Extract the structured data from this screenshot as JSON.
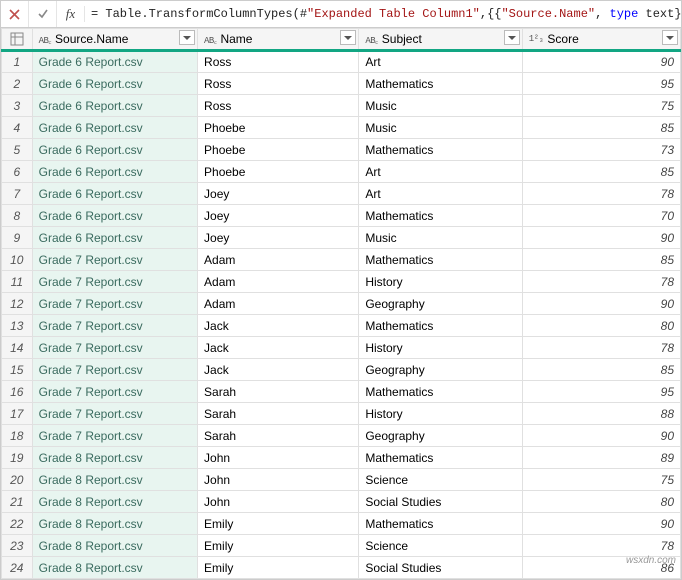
{
  "formulaBar": {
    "prefix": "= Table.TransformColumnTypes(#",
    "expanded": "\"Expanded Table Column1\"",
    "mid": ",{{",
    "sourceName": "\"Source.Name\"",
    "comma": ", ",
    "typeKw": "type ",
    "textKw": "text",
    "suffix": "},"
  },
  "columns": [
    {
      "label": "Source.Name",
      "type": "abc"
    },
    {
      "label": "Name",
      "type": "abc"
    },
    {
      "label": "Subject",
      "type": "abc"
    },
    {
      "label": "Score",
      "type": "123"
    }
  ],
  "rows": [
    {
      "n": 1,
      "src": "Grade 6 Report.csv",
      "name": "Ross",
      "subj": "Art",
      "score": 90
    },
    {
      "n": 2,
      "src": "Grade 6 Report.csv",
      "name": "Ross",
      "subj": "Mathematics",
      "score": 95
    },
    {
      "n": 3,
      "src": "Grade 6 Report.csv",
      "name": "Ross",
      "subj": "Music",
      "score": 75
    },
    {
      "n": 4,
      "src": "Grade 6 Report.csv",
      "name": "Phoebe",
      "subj": "Music",
      "score": 85
    },
    {
      "n": 5,
      "src": "Grade 6 Report.csv",
      "name": "Phoebe",
      "subj": "Mathematics",
      "score": 73
    },
    {
      "n": 6,
      "src": "Grade 6 Report.csv",
      "name": "Phoebe",
      "subj": "Art",
      "score": 85
    },
    {
      "n": 7,
      "src": "Grade 6 Report.csv",
      "name": "Joey",
      "subj": "Art",
      "score": 78
    },
    {
      "n": 8,
      "src": "Grade 6 Report.csv",
      "name": "Joey",
      "subj": "Mathematics",
      "score": 70
    },
    {
      "n": 9,
      "src": "Grade 6 Report.csv",
      "name": "Joey",
      "subj": "Music",
      "score": 90
    },
    {
      "n": 10,
      "src": "Grade 7 Report.csv",
      "name": "Adam",
      "subj": "Mathematics",
      "score": 85
    },
    {
      "n": 11,
      "src": "Grade 7 Report.csv",
      "name": "Adam",
      "subj": "History",
      "score": 78
    },
    {
      "n": 12,
      "src": "Grade 7 Report.csv",
      "name": "Adam",
      "subj": "Geography",
      "score": 90
    },
    {
      "n": 13,
      "src": "Grade 7 Report.csv",
      "name": "Jack",
      "subj": "Mathematics",
      "score": 80
    },
    {
      "n": 14,
      "src": "Grade 7 Report.csv",
      "name": "Jack",
      "subj": "History",
      "score": 78
    },
    {
      "n": 15,
      "src": "Grade 7 Report.csv",
      "name": "Jack",
      "subj": "Geography",
      "score": 85
    },
    {
      "n": 16,
      "src": "Grade 7 Report.csv",
      "name": "Sarah",
      "subj": "Mathematics",
      "score": 95
    },
    {
      "n": 17,
      "src": "Grade 7 Report.csv",
      "name": "Sarah",
      "subj": "History",
      "score": 88
    },
    {
      "n": 18,
      "src": "Grade 7 Report.csv",
      "name": "Sarah",
      "subj": "Geography",
      "score": 90
    },
    {
      "n": 19,
      "src": "Grade 8 Report.csv",
      "name": "John",
      "subj": "Mathematics",
      "score": 89
    },
    {
      "n": 20,
      "src": "Grade 8 Report.csv",
      "name": "John",
      "subj": "Science",
      "score": 75
    },
    {
      "n": 21,
      "src": "Grade 8 Report.csv",
      "name": "John",
      "subj": "Social Studies",
      "score": 80
    },
    {
      "n": 22,
      "src": "Grade 8 Report.csv",
      "name": "Emily",
      "subj": "Mathematics",
      "score": 90
    },
    {
      "n": 23,
      "src": "Grade 8 Report.csv",
      "name": "Emily",
      "subj": "Science",
      "score": 78
    },
    {
      "n": 24,
      "src": "Grade 8 Report.csv",
      "name": "Emily",
      "subj": "Social Studies",
      "score": 86
    }
  ],
  "watermark": "wsxdn.com"
}
